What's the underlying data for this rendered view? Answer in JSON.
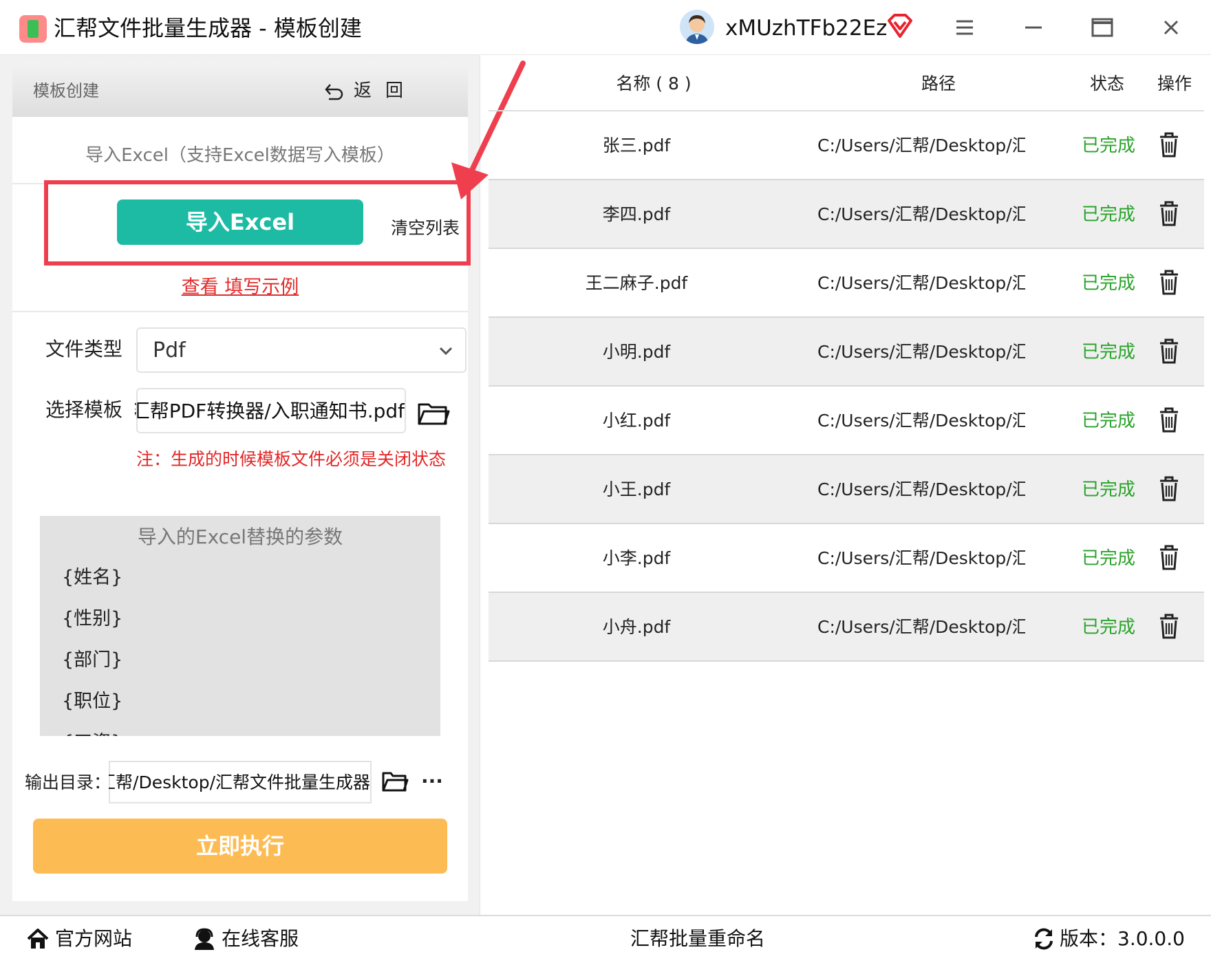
{
  "window": {
    "title": "汇帮文件批量生成器 - 模板创建",
    "username": "xMUzhTFb22Ez"
  },
  "left": {
    "header_title": "模板创建",
    "back_label": "返回",
    "import_hint": "导入Excel（支持Excel数据写入模板）",
    "import_button": "导入Excel",
    "clear_list": "清空列表",
    "example_link": "查看 填写示例",
    "file_type_label": "文件类型",
    "file_type_value": "Pdf",
    "template_label": "选择模板",
    "template_value": "汇帮PDF转换器/入职通知书.pdf",
    "note": "注：生成的时候模板文件必须是关闭状态",
    "params_title": "导入的Excel替换的参数",
    "params": [
      "{姓名}",
      "{性别}",
      "{部门}",
      "{职位}",
      "{工资}"
    ],
    "output_label": "输出目录：",
    "output_value": "汇帮/Desktop/汇帮文件批量生成器",
    "more_label": "···",
    "execute_button": "立即执行"
  },
  "table": {
    "headers": {
      "name": "名称 ( 8 )",
      "path": "路径",
      "status": "状态",
      "op": "操作"
    },
    "rows": [
      {
        "name": "张三.pdf",
        "path": "C:/Users/汇帮/Desktop/汇帮文件",
        "status": "已完成"
      },
      {
        "name": "李四.pdf",
        "path": "C:/Users/汇帮/Desktop/汇帮文件",
        "status": "已完成"
      },
      {
        "name": "王二麻子.pdf",
        "path": "C:/Users/汇帮/Desktop/汇帮文件",
        "status": "已完成"
      },
      {
        "name": "小明.pdf",
        "path": "C:/Users/汇帮/Desktop/汇帮文件",
        "status": "已完成"
      },
      {
        "name": "小红.pdf",
        "path": "C:/Users/汇帮/Desktop/汇帮文件",
        "status": "已完成"
      },
      {
        "name": "小王.pdf",
        "path": "C:/Users/汇帮/Desktop/汇帮文件",
        "status": "已完成"
      },
      {
        "name": "小李.pdf",
        "path": "C:/Users/汇帮/Desktop/汇帮文件",
        "status": "已完成"
      },
      {
        "name": "小舟.pdf",
        "path": "C:/Users/汇帮/Desktop/汇帮文件",
        "status": "已完成"
      }
    ]
  },
  "bottom": {
    "website": "官方网站",
    "support": "在线客服",
    "center": "汇帮批量重命名",
    "version": "版本：3.0.0.0"
  },
  "colors": {
    "primary_teal": "#1dbaa4",
    "execute_orange": "#fdbb53",
    "status_green": "#2aa32a",
    "alert_red": "#ef3f4f"
  }
}
